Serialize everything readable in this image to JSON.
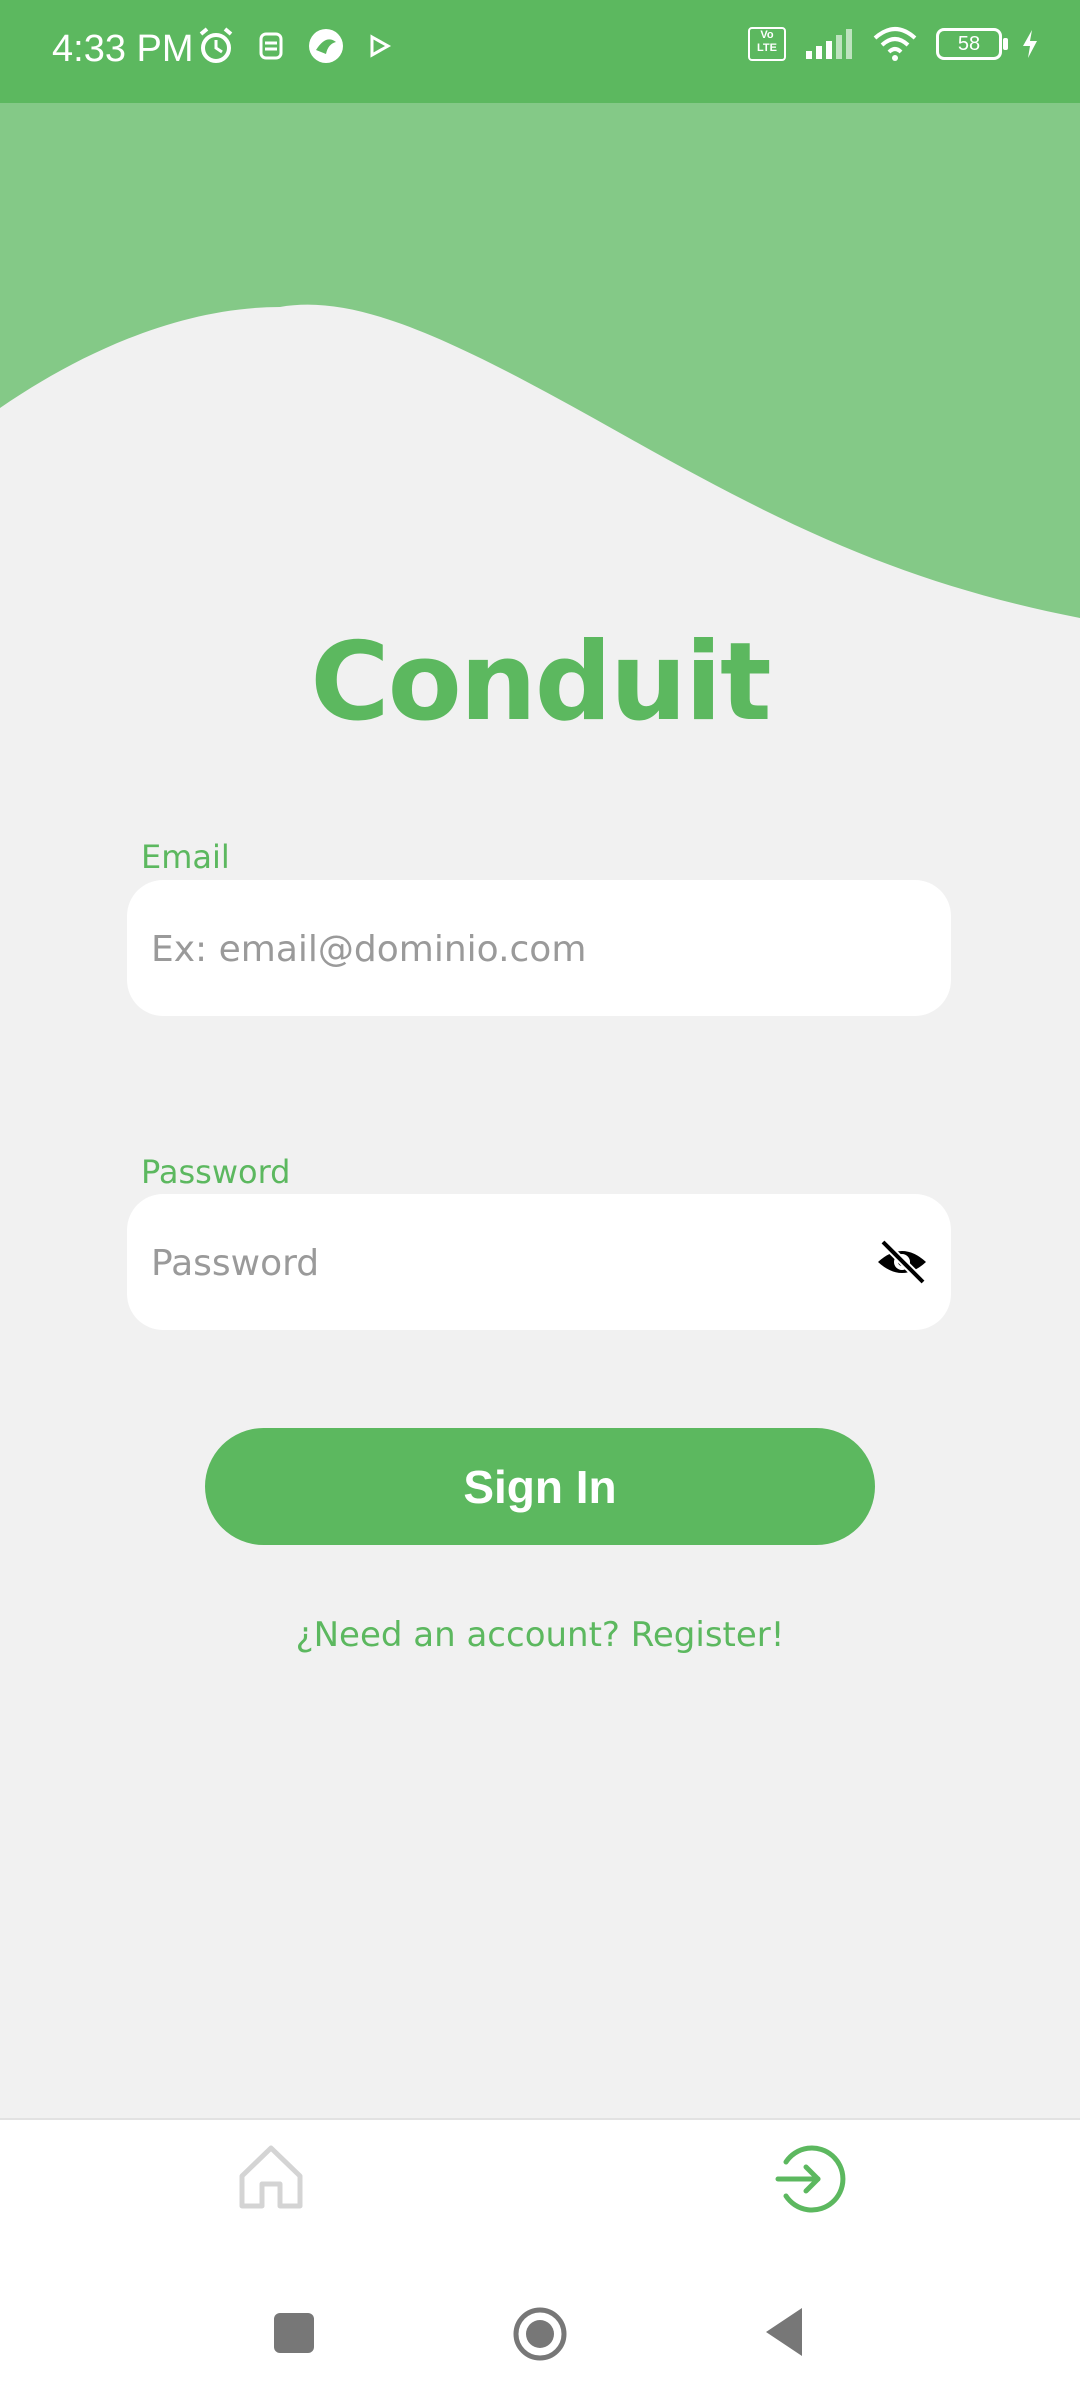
{
  "status_bar": {
    "time": "4:33 PM",
    "left_icons": [
      "alarm-icon",
      "notification-icon",
      "app-icon",
      "play-icon"
    ],
    "right_icons": [
      "volte-icon",
      "signal-icon",
      "wifi-icon",
      "battery-icon",
      "charging-icon"
    ],
    "volte_text": "Vo LTE",
    "battery": "58"
  },
  "app": {
    "title": "Conduit",
    "accent_color": "#5cb85f",
    "wave_color": "#84c987"
  },
  "form": {
    "email_label": "Email",
    "email_placeholder": "Ex: email@dominio.com",
    "email_value": "",
    "password_label": "Password",
    "password_placeholder": "Password",
    "password_value": "",
    "password_toggle_icon": "eye-off-icon",
    "signin_label": "Sign In",
    "register_link": "¿Need an account? Register!"
  },
  "bottom_nav": {
    "items": [
      {
        "icon": "home-icon",
        "active": false
      },
      {
        "icon": "login-icon",
        "active": true
      }
    ]
  },
  "system_nav": {
    "icons": [
      "recents-icon",
      "home-icon",
      "back-icon"
    ]
  }
}
